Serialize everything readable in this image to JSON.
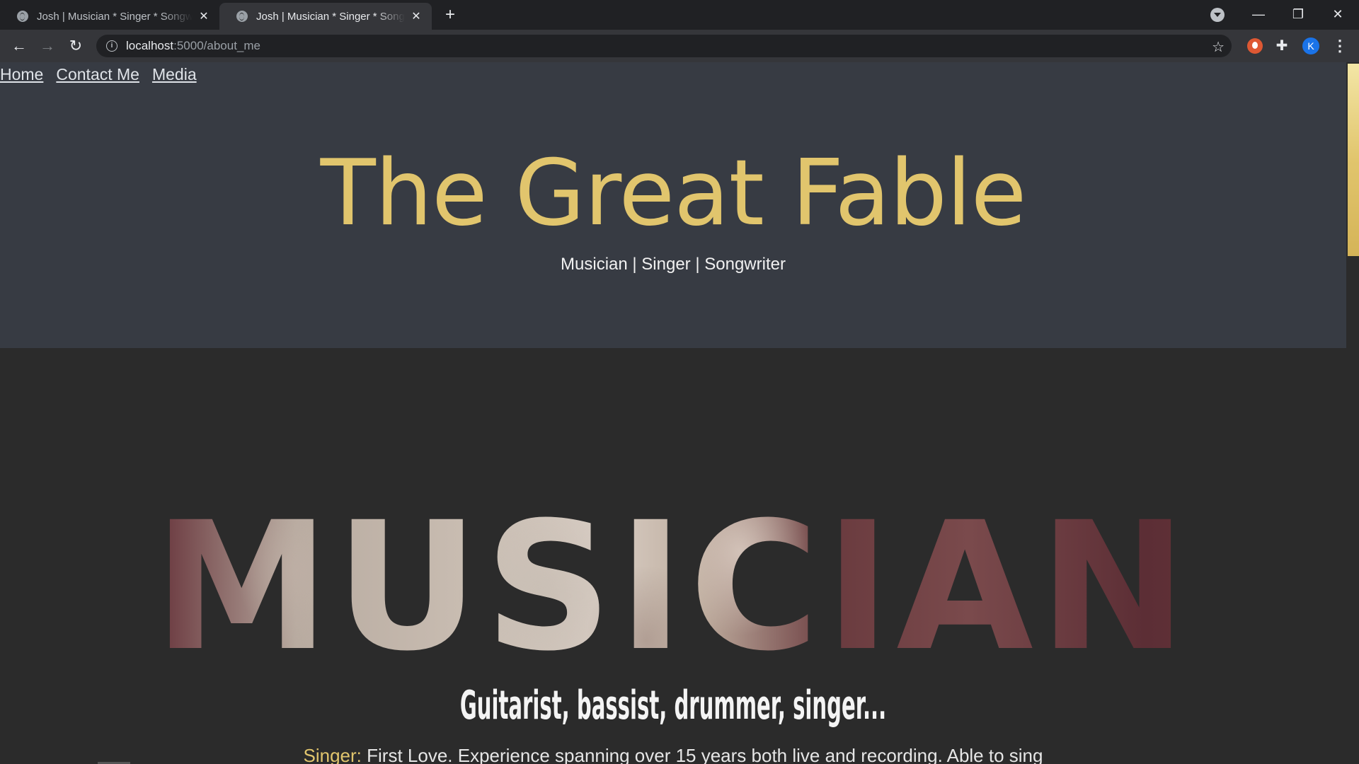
{
  "browser": {
    "tabs": [
      {
        "title": "Josh | Musician * Singer * Songwriter",
        "active": false
      },
      {
        "title": "Josh | Musician * Singer * Songwriter",
        "active": true
      }
    ],
    "new_tab": "+",
    "url_host": "localhost",
    "url_path": ":5000/about_me",
    "profile_initial": "K",
    "window_controls": {
      "minimize": "—",
      "restore": "❐",
      "close": "✕"
    }
  },
  "nav": {
    "links": [
      "Home",
      "Contact Me",
      "Media"
    ]
  },
  "hero": {
    "title": "The Great Fable",
    "subtitle": "Musician | Singer | Songwriter"
  },
  "section": {
    "heading": "MUSICIAN",
    "tagline": "Guitarist, bassist, drummer, singer...",
    "bio_role": "Singer:",
    "bio_text": " First Love. Experience spanning over 15 years both live and recording. Able to sing"
  },
  "colors": {
    "accent": "#e1c56d",
    "hero_bg": "#373b43",
    "page_bg": "#2b2b2b"
  }
}
